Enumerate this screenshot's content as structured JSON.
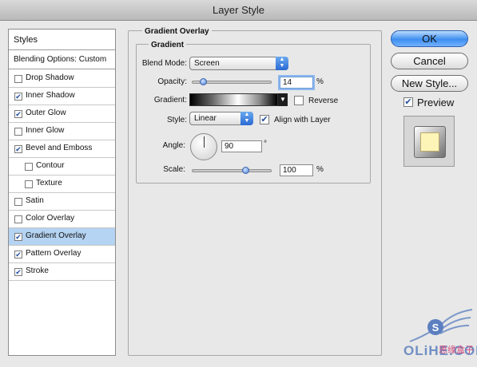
{
  "window": {
    "title": "Layer Style"
  },
  "sidebar": {
    "styles_header": "Styles",
    "blending_header": "Blending Options: Custom",
    "items": [
      {
        "label": "Drop Shadow",
        "checked": false,
        "indent": false,
        "selected": false
      },
      {
        "label": "Inner Shadow",
        "checked": true,
        "indent": false,
        "selected": false
      },
      {
        "label": "Outer Glow",
        "checked": true,
        "indent": false,
        "selected": false
      },
      {
        "label": "Inner Glow",
        "checked": false,
        "indent": false,
        "selected": false
      },
      {
        "label": "Bevel and Emboss",
        "checked": true,
        "indent": false,
        "selected": false
      },
      {
        "label": "Contour",
        "checked": false,
        "indent": true,
        "selected": false
      },
      {
        "label": "Texture",
        "checked": false,
        "indent": true,
        "selected": false
      },
      {
        "label": "Satin",
        "checked": false,
        "indent": false,
        "selected": false
      },
      {
        "label": "Color Overlay",
        "checked": false,
        "indent": false,
        "selected": false
      },
      {
        "label": "Gradient Overlay",
        "checked": true,
        "indent": false,
        "selected": true
      },
      {
        "label": "Pattern Overlay",
        "checked": true,
        "indent": false,
        "selected": false
      },
      {
        "label": "Stroke",
        "checked": true,
        "indent": false,
        "selected": false
      }
    ]
  },
  "panel": {
    "section_title": "Gradient Overlay",
    "group_title": "Gradient",
    "blend_mode_label": "Blend Mode:",
    "blend_mode_value": "Screen",
    "opacity_label": "Opacity:",
    "opacity_value": "14",
    "opacity_unit": "%",
    "opacity_fraction": 0.14,
    "gradient_label": "Gradient:",
    "reverse_label": "Reverse",
    "reverse_checked": false,
    "style_label": "Style:",
    "style_value": "Linear",
    "align_label": "Align with Layer",
    "align_checked": true,
    "angle_label": "Angle:",
    "angle_value": "90",
    "angle_unit": "°",
    "scale_label": "Scale:",
    "scale_value": "100",
    "scale_unit": "%",
    "scale_fraction": 0.67
  },
  "buttons": {
    "ok": "OK",
    "cancel": "Cancel",
    "new_style": "New Style..."
  },
  "preview": {
    "label": "Preview",
    "checked": true
  },
  "watermark": {
    "text": "OLiHE.COM",
    "cn": "思缘盒子"
  },
  "colors": {
    "accent": "#3e8ff0",
    "selection": "#b5d3f2",
    "check": "#234ea0"
  }
}
